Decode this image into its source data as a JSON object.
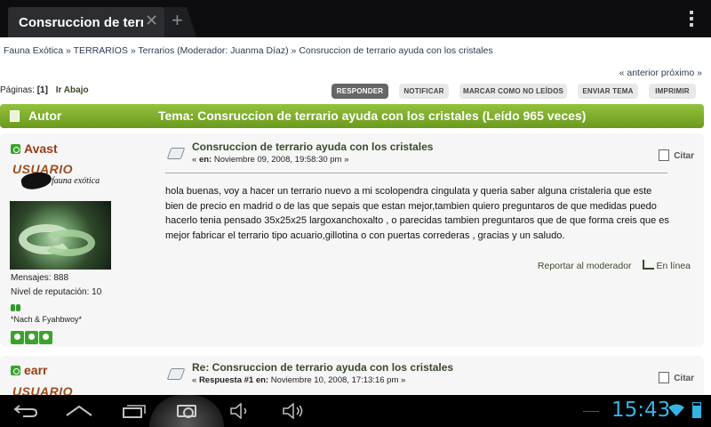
{
  "browser": {
    "tab_title": "Consruccion de terrar",
    "close_glyph": "✕",
    "newtab_glyph": "+"
  },
  "breadcrumb": {
    "items": [
      "Fauna Exótica",
      "TERRARIOS",
      "Terrarios (Moderador: Juanma Díaz)",
      "Consruccion de terrario ayuda con los cristales"
    ],
    "separator": "»"
  },
  "nav": {
    "prev": "« anterior",
    "next": "próximo »"
  },
  "pagination": {
    "label": "Páginas:",
    "current": "[1]",
    "go_down": "Ir Abajo"
  },
  "buttons": {
    "reply": "RESPONDER",
    "notify": "NOTIFICAR",
    "mark_unread": "MARCAR COMO NO LEÍDOS",
    "send_topic": "ENVIAR TEMA",
    "print": "IMPRIMIR"
  },
  "header": {
    "author_label": "Autor",
    "topic_text": "Tema: Consruccion de terrario ayuda con los cristales  (Leído 965 veces)"
  },
  "posts": [
    {
      "author": "Avast",
      "rank_title": "USUARIO",
      "rank_subtitle": "fauna exótica",
      "messages": "Mensajes: 888",
      "reputation": "Nivel de reputación: 10",
      "signature_nick": "*Nach & Fyahbwoy*",
      "subject": "Consruccion de terrario ayuda con los cristales",
      "meta_prefix": "«",
      "meta_label": "en:",
      "meta_date": "Noviembre 09, 2008, 19:58:30 pm »",
      "quote": "Citar",
      "body": "hola buenas, voy a hacer un terrario nuevo a mi scolopendra cingulata y queria saber alguna cristaleria que este bien de precio en madrid o de las que sepais que estan mejor,tambien quiero preguntaros de que medidas puedo hacerlo tenia pensado 35x25x25 largoxanchoxalto , o parecidas tambien preguntaros que de que forma creis que es mejor fabricar el terrario tipo acuario,gillotina o con puertas correderas , gracias y un saludo.",
      "report": "Reportar al moderador",
      "online": "En línea"
    },
    {
      "author": "earr",
      "rank_title": "USUARIO",
      "subject": "Re: Consruccion de terrario ayuda con los cristales",
      "meta_prefix": "«",
      "meta_label": "Respuesta #1 en:",
      "meta_date": "Noviembre 10, 2008, 17:13:16 pm »",
      "quote": "Citar"
    }
  ],
  "system_bar": {
    "clock": "15:43"
  },
  "colors": {
    "header_green": "#7aab27",
    "author_red": "#9a3b11",
    "clock_blue": "#33b5e5"
  }
}
